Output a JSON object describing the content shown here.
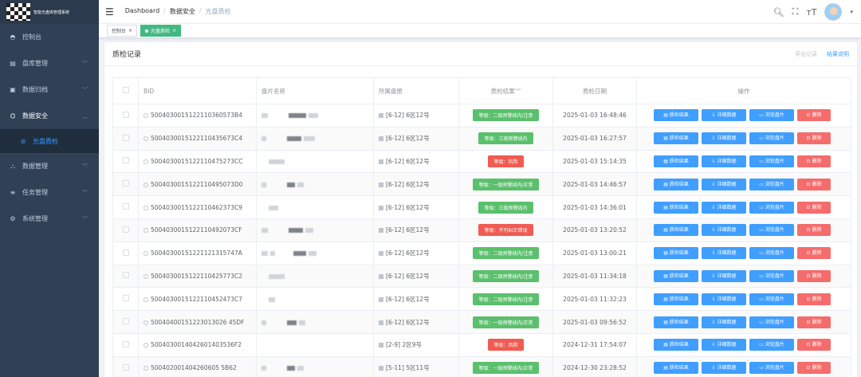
{
  "sidebar": {
    "logo_text": "智能光盘库管理系统",
    "items": [
      {
        "label": "控制台",
        "icon": "dashboard-icon",
        "arrow": false
      },
      {
        "label": "盘库管理",
        "icon": "library-icon",
        "arrow": true
      },
      {
        "label": "数据归档",
        "icon": "archive-icon",
        "arrow": true
      },
      {
        "label": "数据安全",
        "icon": "security-icon",
        "arrow": true
      },
      {
        "label": "光盘质检",
        "icon": "disc-check-icon",
        "sub": true
      },
      {
        "label": "数据管理",
        "icon": "data-icon",
        "arrow": true
      },
      {
        "label": "任务管理",
        "icon": "task-icon",
        "arrow": true
      },
      {
        "label": "系统管理",
        "icon": "settings-icon",
        "arrow": true
      }
    ]
  },
  "header": {
    "breadcrumb": [
      "Dashboard",
      "数据安全",
      "光盘质检"
    ]
  },
  "tags": [
    {
      "label": "控制台",
      "active": false
    },
    {
      "label": "光盘质检",
      "active": true
    }
  ],
  "card": {
    "title": "质检记录",
    "export_label": "导出记录",
    "explain_label": "结果说明"
  },
  "table": {
    "headers": [
      "",
      "BID",
      "盘片名称",
      "所属盘匣",
      "质检结果",
      "质检日期",
      "操作"
    ],
    "actions": [
      "质检结果",
      "详细数据",
      "浏览盘片",
      "删除"
    ],
    "rows": [
      {
        "bid": "5004030015122110360573B4",
        "slot": "[6-12] 6区12号",
        "result": "等级：二级预警线内/注意",
        "status": "green",
        "date": "2025-01-03 16:48:46"
      },
      {
        "bid": "5004030015122110435673C4",
        "slot": "[6-12] 6区12号",
        "result": "等级：三级预警线内",
        "status": "green",
        "date": "2025-01-03 16:27:57"
      },
      {
        "bid": "5004030015122110475273CC",
        "slot": "[6-12] 6区12号",
        "result": "等级：风险",
        "status": "red",
        "date": "2025-01-03 15:14:35"
      },
      {
        "bid": "5004030015122110495073D0",
        "slot": "[6-12] 6区12号",
        "result": "等级：一级预警线内/正常",
        "status": "green",
        "date": "2025-01-03 14:46:57"
      },
      {
        "bid": "5004030015122110462373C9",
        "slot": "[6-12] 6区12号",
        "result": "等级：三级预警线内",
        "status": "green",
        "date": "2025-01-03 14:36:01"
      },
      {
        "bid": "5004030015122110492073CF",
        "slot": "[6-12] 6区12号",
        "result": "等级：不可纠正错误",
        "status": "red",
        "date": "2025-01-03 13:20:52"
      },
      {
        "bid": "5004030015122112131574 7A",
        "slot": "[6-12] 6区12号",
        "result": "等级：二级预警线内/注意",
        "status": "green",
        "date": "2025-01-03 13:00:21"
      },
      {
        "bid": "5004030015122110425773C2",
        "slot": "[6-12] 6区12号",
        "result": "等级：二级预警线内/注意",
        "status": "green",
        "date": "2025-01-03 11:34:18"
      },
      {
        "bid": "5004030015122110452473C7",
        "slot": "[6-12] 6区12号",
        "result": "等级：二级预警线内/注意",
        "status": "green",
        "date": "2025-01-03 11:32:23"
      },
      {
        "bid": "500404001512230130264 5DF",
        "slot": "[6-12] 6区12号",
        "result": "等级：一级预警线内/正常",
        "status": "green",
        "date": "2025-01-03 09:56:52"
      },
      {
        "bid": "5004030014042601403536F2",
        "slot": "[2-9] 2区9号",
        "result": "等级：风险",
        "status": "red",
        "date": "2024-12-31 17:54:07"
      },
      {
        "bid": "5004020014042606055B62",
        "slot": "[5-11] 5区11号",
        "result": "等级：一级预警线内/正常",
        "status": "green",
        "date": "2024-12-30 23:28:52"
      }
    ]
  }
}
